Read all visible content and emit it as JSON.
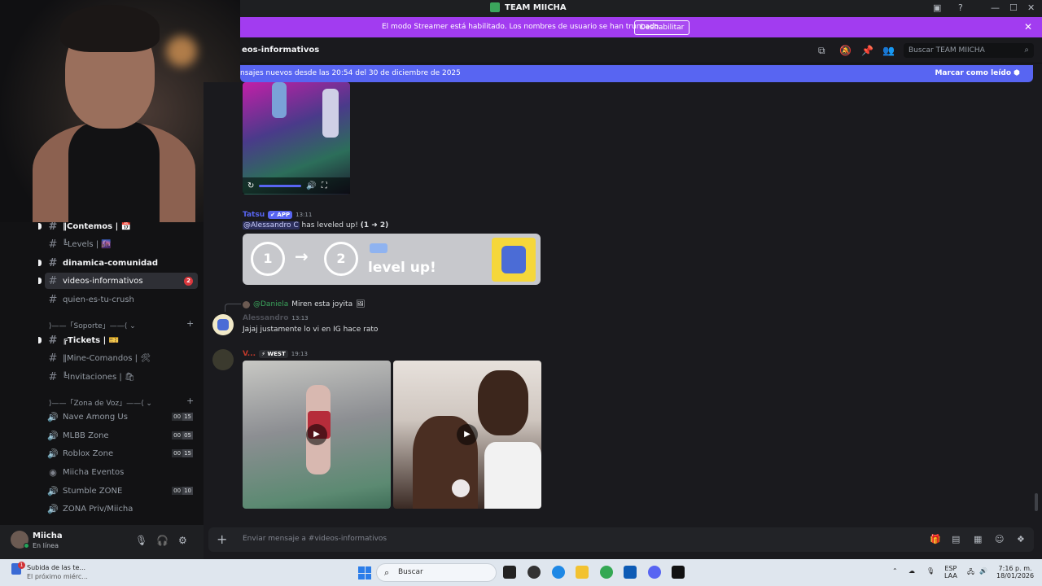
{
  "window": {
    "title": "TEAM MIICHA"
  },
  "banner": {
    "message": "El modo Streamer está habilitado. Los nombres de usuario se han truncado.",
    "button": "Deshabilitar"
  },
  "header": {
    "channel": "eos-informativos",
    "search_placeholder": "Buscar TEAM MIICHA"
  },
  "newbar": {
    "text": "nsajes nuevos desde las 20:54 del 30 de diciembre de 2025",
    "mark_read": "Marcar como leído"
  },
  "sidebar": {
    "channels": [
      {
        "label": "‖Contemos |  📅",
        "kind": "text",
        "bold": true
      },
      {
        "label": "╚Levels | 🌆",
        "kind": "text"
      },
      {
        "label": "dinamica-comunidad",
        "kind": "text",
        "bold": true
      },
      {
        "label": "videos-informativos",
        "kind": "text",
        "active": true,
        "badge": "2"
      },
      {
        "label": "quien-es-tu-crush",
        "kind": "text"
      }
    ],
    "category_support": "⟩——「Soporte」——⟨ ⌄",
    "support_channels": [
      {
        "label": "╔Tickets |  🎫",
        "kind": "text",
        "bold": true
      },
      {
        "label": "‖Mine-Comandos | 🛠",
        "kind": "text"
      },
      {
        "label": "╚Invitaciones | 🛍",
        "kind": "text"
      }
    ],
    "category_voice": "⟩——「Zona de Voz」——⟨ ⌄",
    "voice_channels": [
      {
        "label": "Nave Among Us",
        "count_a": "00",
        "count_b": "15"
      },
      {
        "label": "MLBB Zone",
        "count_a": "00",
        "count_b": "05"
      },
      {
        "label": "Roblox Zone",
        "count_a": "00",
        "count_b": "15"
      },
      {
        "label": "Miicha Eventos"
      },
      {
        "label": "Stumble ZONE",
        "count_a": "00",
        "count_b": "10"
      },
      {
        "label": "ZONA Priv/Miicha"
      }
    ]
  },
  "user": {
    "name": "Miicha",
    "status": "En línea"
  },
  "messages": {
    "bot_name": "Tatsu",
    "bot_tag": "✔ APP",
    "bot_time": "13:11",
    "bot_mention": "@Alessandro C",
    "bot_text": "has leveled up!",
    "bot_levels": "(1 ➜ 2)",
    "level_from": "1",
    "level_to": "2",
    "level_label": "level up!",
    "reply_mention": "@Daniela",
    "reply_text": "Miren esta joyita",
    "msg2_author": "Alessandro",
    "msg2_time": "13:13",
    "msg2_text": "Jajaj justamente lo vi en IG hace rato",
    "msg3_author": "V...",
    "msg3_tag": "⚡ WEST",
    "msg3_time": "19:13"
  },
  "composer": {
    "placeholder": "Enviar mensaje a #videos-informativos"
  },
  "taskbar": {
    "notif_title": "Subida de las te...",
    "notif_sub": "El próximo miérc...",
    "search": "Buscar",
    "lang_top": "ESP",
    "lang_bottom": "LAA",
    "time": "7:16 p. m.",
    "date": "18/01/2026"
  },
  "colors": {
    "accent": "#5865f2",
    "streamer": "#a23cf0",
    "online": "#23a55a",
    "badge": "#da373c"
  }
}
